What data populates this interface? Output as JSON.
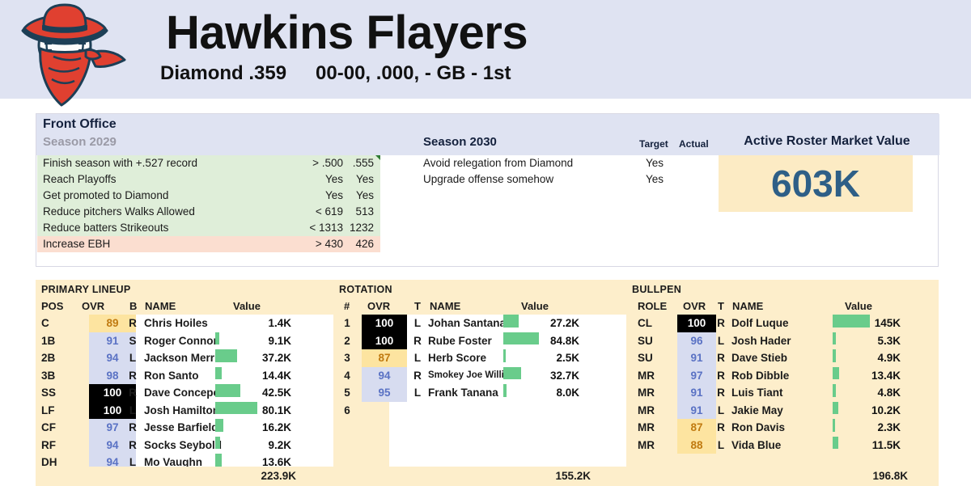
{
  "header": {
    "team_name": "Hawkins Flayers",
    "league": "Diamond .359",
    "record": "00-00, .000, - GB - 1st",
    "logo_name": "baseball-cowboy-bandit-logo",
    "banner_color": "#dfe3f2"
  },
  "front_office": {
    "title": "Front Office",
    "left_season_label": "Season 2029",
    "right_season_label": "Season 2030",
    "col_target": "Target",
    "col_actual": "Actual",
    "market_value_title": "Active Roster Market Value",
    "market_value": "603K",
    "market_value_color": "#2e5f87",
    "goals_2029": [
      {
        "name": "Finish season with +.527 record",
        "target": "> .500",
        "actual": ".555",
        "status": "ok",
        "flag": true
      },
      {
        "name": "Reach Playoffs",
        "target": "Yes",
        "actual": "Yes",
        "status": "ok",
        "flag": false
      },
      {
        "name": "Get promoted to Diamond",
        "target": "Yes",
        "actual": "Yes",
        "status": "ok",
        "flag": false
      },
      {
        "name": "Reduce pitchers Walks Allowed",
        "target": "< 619",
        "actual": "513",
        "status": "ok",
        "flag": false
      },
      {
        "name": "Reduce batters Strikeouts",
        "target": "< 1313",
        "actual": "1232",
        "status": "ok",
        "flag": false
      },
      {
        "name": "Increase EBH",
        "target": "> 430",
        "actual": "426",
        "status": "bad",
        "flag": false
      }
    ],
    "goals_2030": [
      {
        "name": "Avoid relegation from Diamond",
        "target": "Yes",
        "actual": ""
      },
      {
        "name": "Upgrade offense somehow",
        "target": "Yes",
        "actual": ""
      }
    ]
  },
  "lineup": {
    "section_title": "PRIMARY LINEUP",
    "headers": {
      "pos": "POS",
      "ovr": "OVR",
      "hand": "B",
      "name": "NAME",
      "value": "Value"
    },
    "total": "223.9K",
    "rows": [
      {
        "pos": "C",
        "ovr": "89",
        "tier": "low",
        "hand": "R",
        "name": "Chris Hoiles",
        "value": "1.4K",
        "bar": 0
      },
      {
        "pos": "1B",
        "ovr": "91",
        "tier": "mid",
        "hand": "S",
        "name": "Roger Connor",
        "value": "9.1K",
        "bar": 5
      },
      {
        "pos": "2B",
        "ovr": "94",
        "tier": "mid",
        "hand": "L",
        "name": "Jackson Merrill",
        "value": "37.2K",
        "bar": 27
      },
      {
        "pos": "3B",
        "ovr": "98",
        "tier": "mid",
        "hand": "R",
        "name": "Ron Santo",
        "value": "14.4K",
        "bar": 8
      },
      {
        "pos": "SS",
        "ovr": "100",
        "tier": "max",
        "hand": "R",
        "name": "Dave Concepcion",
        "value": "42.5K",
        "bar": 31
      },
      {
        "pos": "LF",
        "ovr": "100",
        "tier": "max",
        "hand": "L",
        "name": "Josh Hamilton",
        "value": "80.1K",
        "bar": 52
      },
      {
        "pos": "CF",
        "ovr": "97",
        "tier": "mid",
        "hand": "R",
        "name": "Jesse Barfield",
        "value": "16.2K",
        "bar": 10
      },
      {
        "pos": "RF",
        "ovr": "94",
        "tier": "mid",
        "hand": "R",
        "name": "Socks Seybold",
        "value": "9.2K",
        "bar": 6
      },
      {
        "pos": "DH",
        "ovr": "94",
        "tier": "mid",
        "hand": "L",
        "name": "Mo Vaughn",
        "value": "13.6K",
        "bar": 8
      }
    ]
  },
  "rotation": {
    "section_title": "ROTATION",
    "headers": {
      "num": "#",
      "ovr": "OVR",
      "hand": "T",
      "name": "NAME",
      "value": "Value"
    },
    "total": "155.2K",
    "rows": [
      {
        "num": "1",
        "ovr": "100",
        "tier": "max",
        "hand": "L",
        "name": "Johan Santana",
        "value": "27.2K",
        "bar": 19,
        "small": false
      },
      {
        "num": "2",
        "ovr": "100",
        "tier": "max",
        "hand": "R",
        "name": "Rube Foster",
        "value": "84.8K",
        "bar": 44,
        "small": false
      },
      {
        "num": "3",
        "ovr": "87",
        "tier": "low",
        "hand": "L",
        "name": "Herb Score",
        "value": "2.5K",
        "bar": 3,
        "small": false
      },
      {
        "num": "4",
        "ovr": "94",
        "tier": "mid",
        "hand": "R",
        "name": "Smokey Joe Williams",
        "value": "32.7K",
        "bar": 22,
        "small": true
      },
      {
        "num": "5",
        "ovr": "95",
        "tier": "mid",
        "hand": "L",
        "name": "Frank Tanana",
        "value": "8.0K",
        "bar": 4,
        "small": false
      },
      {
        "num": "6",
        "ovr": "",
        "tier": "none",
        "hand": "",
        "name": "",
        "value": "",
        "bar": 0,
        "small": false
      }
    ]
  },
  "bullpen": {
    "section_title": "BULLPEN",
    "headers": {
      "role": "ROLE",
      "ovr": "OVR",
      "hand": "T",
      "name": "NAME",
      "value": "Value"
    },
    "total": "196.8K",
    "rows": [
      {
        "role": "CL",
        "ovr": "100",
        "tier": "max",
        "hand": "R",
        "name": "Dolf Luque",
        "value": "145K",
        "bar": 46
      },
      {
        "role": "SU",
        "ovr": "96",
        "tier": "mid",
        "hand": "L",
        "name": "Josh Hader",
        "value": "5.3K",
        "bar": 4
      },
      {
        "role": "SU",
        "ovr": "91",
        "tier": "mid",
        "hand": "R",
        "name": "Dave Stieb",
        "value": "4.9K",
        "bar": 4
      },
      {
        "role": "MR",
        "ovr": "97",
        "tier": "mid",
        "hand": "R",
        "name": "Rob Dibble",
        "value": "13.4K",
        "bar": 8
      },
      {
        "role": "MR",
        "ovr": "91",
        "tier": "mid",
        "hand": "R",
        "name": "Luis Tiant",
        "value": "4.8K",
        "bar": 4
      },
      {
        "role": "MR",
        "ovr": "91",
        "tier": "mid",
        "hand": "L",
        "name": "Jakie May",
        "value": "10.2K",
        "bar": 7
      },
      {
        "role": "MR",
        "ovr": "87",
        "tier": "low",
        "hand": "R",
        "name": "Ron Davis",
        "value": "2.3K",
        "bar": 3
      },
      {
        "role": "MR",
        "ovr": "88",
        "tier": "low",
        "hand": "L",
        "name": "Vida Blue",
        "value": "11.5K",
        "bar": 7
      }
    ]
  },
  "colors": {
    "bar_green": "#69cc8b",
    "ovr_low_bg": "#fde4a0",
    "ovr_mid_bg": "#d7dcf0",
    "ovr_max_bg": "#000000",
    "panel_cream": "#fdeecb",
    "goal_ok": "#dfeed9",
    "goal_bad": "#fbded0"
  }
}
